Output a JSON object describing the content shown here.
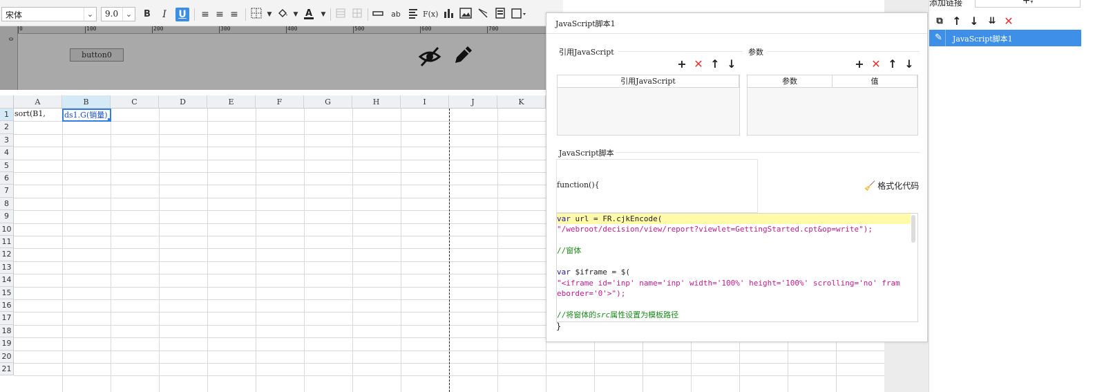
{
  "toolbar": {
    "font_family": "宋体",
    "font_size": "9.0",
    "bold": "B",
    "italic": "I",
    "underline": "U",
    "align_left": "≡",
    "align_center": "≡",
    "align_right": "≡",
    "text_label": "ab",
    "formula": "F(x)"
  },
  "design": {
    "ruler_ticks": [
      "0",
      "100",
      "200",
      "300",
      "400",
      "500",
      "600",
      "700"
    ],
    "ruler_v": "0",
    "button_label": "button0"
  },
  "grid": {
    "columns": [
      "A",
      "B",
      "C",
      "D",
      "E",
      "F",
      "G",
      "H",
      "I",
      "J",
      "K"
    ],
    "rows": [
      "1",
      "2",
      "3",
      "4",
      "5",
      "6",
      "7",
      "8",
      "9",
      "10",
      "11",
      "12",
      "13",
      "14",
      "15",
      "16",
      "17",
      "18",
      "19",
      "20",
      "21"
    ],
    "cell_A1": "sort(B1,",
    "cell_B1": "ds1.G(销量)"
  },
  "dialog": {
    "title": "JavaScript脚本1",
    "ref_section": "引用JavaScript",
    "param_section": "参数",
    "ref_table_header": "引用JavaScript",
    "param_table_headers": [
      "参数",
      "值"
    ],
    "script_section": "JavaScript脚本",
    "function_header": "function(){",
    "format_button": "格式化代码",
    "closing_brace": "}",
    "code": {
      "l1_kw": "var",
      "l1_rest": " url = FR.cjkEncode(",
      "l2": "\"/webroot/decision/view/report?viewlet=GettingStarted.cpt&op=write\");",
      "l3": "//窗体",
      "l4_kw": "var",
      "l4_rest": " $iframe = $(",
      "l5": "\"<iframe id='inp' name='inp' width='100%' height='100%' scrolling='no' fram",
      "l6": "eborder='0'>\");",
      "l7_a": "//将窗体的",
      "l7_b": "src",
      "l7_c": "属性设置为模板路径"
    }
  },
  "right_panel": {
    "title": "添加链接",
    "add": "+",
    "item_label": "JavaScript脚本1"
  },
  "colors": {
    "accent": "#3d8fe8",
    "delete": "#e3342f",
    "keyword": "#1a1aa6",
    "string": "#c41a91",
    "comment": "#1c8a1c"
  }
}
